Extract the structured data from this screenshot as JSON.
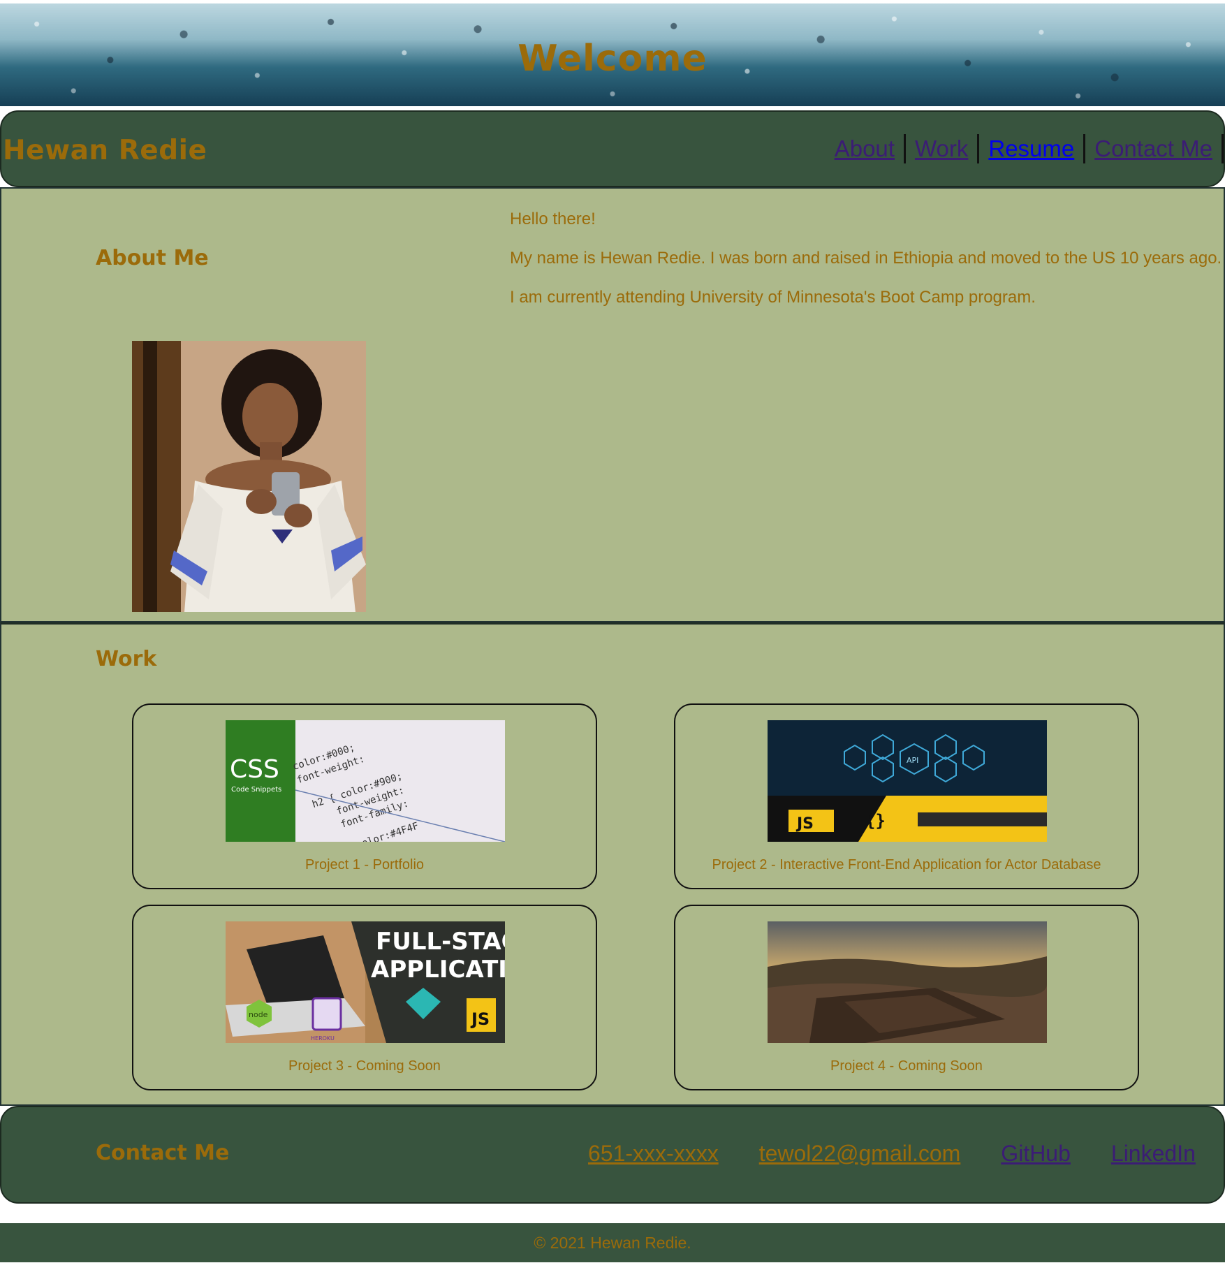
{
  "hero": {
    "title": "Welcome"
  },
  "header": {
    "site_name": "Hewan Redie",
    "nav": [
      {
        "label": "About",
        "state": "visited"
      },
      {
        "label": "Work",
        "state": "visited"
      },
      {
        "label": "Resume",
        "state": "unvisited"
      },
      {
        "label": "Contact Me",
        "state": "visited"
      }
    ]
  },
  "about": {
    "heading": "About Me",
    "paragraphs": [
      "Hello there!",
      "My name is Hewan Redie. I was born and raised in Ethiopia and moved to the US 10 years ago.",
      "I am currently attending University of Minnesota's Boot Camp program."
    ]
  },
  "work": {
    "heading": "Work",
    "projects": [
      {
        "caption": "Project 1 - Portfolio",
        "thumb_text": [
          "CSS",
          "Code Snippets"
        ]
      },
      {
        "caption": "Project 2 - Interactive Front-End Application for Actor Database",
        "thumb_text": [
          "API",
          "JS",
          "{}"
        ]
      },
      {
        "caption": "Project 3 - Coming Soon",
        "thumb_text": [
          "FULL-STACK",
          "APPLICATION",
          "node",
          "HEROKU",
          "JS"
        ]
      },
      {
        "caption": "Project 4 - Coming Soon",
        "thumb_text": []
      }
    ]
  },
  "contact": {
    "heading": "Contact Me",
    "links": [
      {
        "label": "651-xxx-xxxx",
        "color": "#9b6b0a"
      },
      {
        "label": "tewol22@gmail.com",
        "color": "#9b6b0a"
      },
      {
        "label": "GitHub",
        "color": "#3b1c75"
      },
      {
        "label": "LinkedIn",
        "color": "#3b1c75"
      }
    ]
  },
  "footer": {
    "text": "© 2021 Hewan Redie."
  },
  "colors": {
    "accent": "#9b6b0a",
    "dark_green": "#38543e",
    "sage": "#adb98b",
    "visited_link": "#3b1c75",
    "link": "#0000ee"
  }
}
